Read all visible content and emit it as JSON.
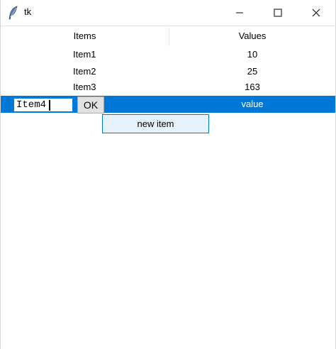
{
  "window": {
    "title": "tk",
    "icon": "feather-icon",
    "controls": {
      "minimize": "minimize-icon",
      "maximize": "maximize-icon",
      "close": "close-icon"
    }
  },
  "tree": {
    "columns": [
      "Items",
      "Values"
    ],
    "rows": [
      {
        "item": "Item1",
        "value": "10"
      },
      {
        "item": "Item2",
        "value": "25"
      },
      {
        "item": "Item3",
        "value": "163"
      },
      {
        "item": "",
        "value": "value",
        "selected": true
      }
    ]
  },
  "editor": {
    "entry_value": "Item4",
    "ok_label": "OK",
    "dropdown_items": [
      "new item"
    ]
  },
  "colors": {
    "selection": "#0078d7",
    "dropdown_bg": "#e5f1fb"
  }
}
